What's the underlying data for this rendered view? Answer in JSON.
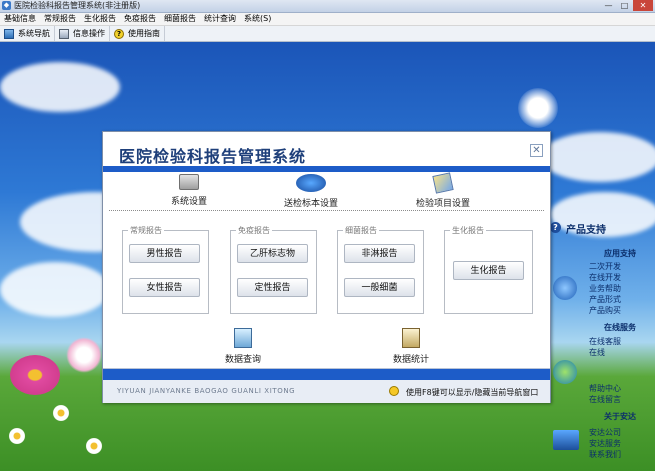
{
  "window": {
    "title": "医院检验科报告管理系统(非注册版)",
    "min": "—",
    "max": "□",
    "close": "✕"
  },
  "menubar": [
    "基础信息",
    "常规报告",
    "生化报告",
    "免疫报告",
    "细菌报告",
    "统计查询",
    "系统(S)"
  ],
  "toolbar": [
    {
      "label": "系统导航",
      "icon": "navigation-icon"
    },
    {
      "label": "信息操作",
      "icon": "info-operation-icon"
    },
    {
      "label": "使用指南",
      "icon": "help-icon"
    }
  ],
  "dialog": {
    "title": "医院检验科报告管理系统",
    "close": "✕",
    "top_tools": [
      {
        "label": "系统设置",
        "icon": "gear-icon"
      },
      {
        "label": "送检标本设置",
        "icon": "sample-icon"
      },
      {
        "label": "检验项目设置",
        "icon": "book-icon"
      }
    ],
    "groups": [
      {
        "label": "常规报告",
        "buttons": [
          "男性报告",
          "女性报告"
        ]
      },
      {
        "label": "免疫报告",
        "buttons": [
          "乙肝标志物",
          "定性报告"
        ]
      },
      {
        "label": "细菌报告",
        "buttons": [
          "非淋报告",
          "一般细菌"
        ]
      },
      {
        "label": "生化报告",
        "buttons": [
          "生化报告"
        ]
      }
    ],
    "bottom_tools": [
      {
        "label": "数据查询",
        "icon": "query-icon"
      },
      {
        "label": "数据统计",
        "icon": "statistics-icon"
      }
    ],
    "footer": {
      "pinyin": "YIYUAN JIANYANKE BAOGAO GUANLI XITONG",
      "hint": "使用F8键可以显示/隐藏当前导航窗口"
    }
  },
  "side_panel": {
    "title": "产品支持",
    "sections": [
      {
        "heading": "应用支持",
        "items": [
          "二次开发",
          "在线开发",
          "业务帮助",
          "产品形式",
          "产品购买"
        ]
      },
      {
        "heading": "在线服务",
        "items": [
          "在线客服",
          "在线",
          "",
          "帮助中心",
          "在线留言"
        ]
      },
      {
        "heading": "关于安达",
        "items": [
          "安达公司",
          "安达服务",
          "联系我们"
        ]
      }
    ]
  }
}
